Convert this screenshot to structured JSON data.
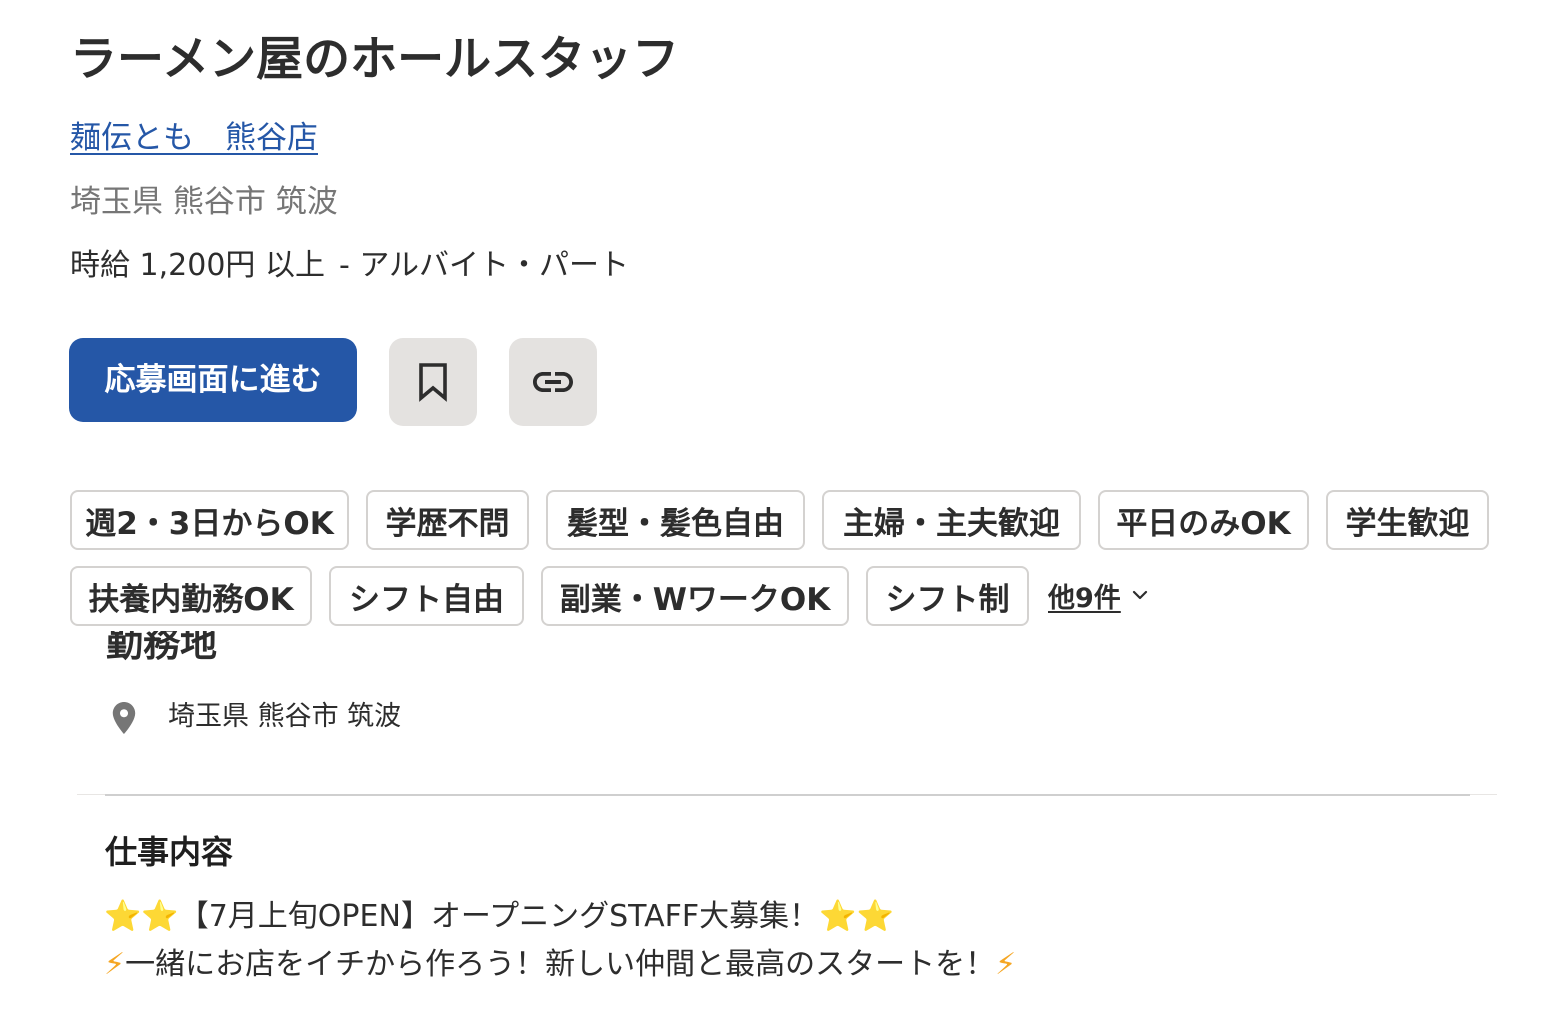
{
  "job": {
    "title": "ラーメン屋のホールスタッフ",
    "company": "麺伝とも　熊谷店",
    "location": "埼玉県 熊谷市 筑波",
    "salary": "時給 1,200円 以上",
    "job_type": "- アルバイト・パート"
  },
  "actions": {
    "apply_label": "応募画面に進む",
    "save_icon": "bookmark-icon",
    "share_icon": "link-icon"
  },
  "tags": [
    "週2・3日からOK",
    "学歴不問",
    "髪型・髪色自由",
    "主婦・主夫歓迎",
    "平日のみOK",
    "学生歓迎",
    "扶養内勤務OK",
    "シフト自由",
    "副業・WワークOK",
    "シフト制"
  ],
  "more_tags": {
    "label": "他9件",
    "icon": "chevron-down-icon"
  },
  "work_location": {
    "heading": "勤務地",
    "icon": "map-pin-icon",
    "address": "埼玉県 熊谷市 筑波"
  },
  "job_description": {
    "heading": "仕事内容",
    "lines": [
      {
        "lead": "⭐⭐",
        "body": "【7月上旬OPEN】オープニングSTAFF大募集！",
        "trail": "⭐⭐"
      },
      {
        "lead": "⚡",
        "body": "一緒にお店をイチから作ろう！新しい仲間と最高のスタートを！",
        "trail": "⚡"
      }
    ]
  },
  "colors": {
    "accent": "#2557a7",
    "link": "#2557a7",
    "star": "#f5c518",
    "bolt": "#f5a623",
    "chip_border": "#d4d2d0",
    "icon_button_bg": "#e4e2e0"
  }
}
